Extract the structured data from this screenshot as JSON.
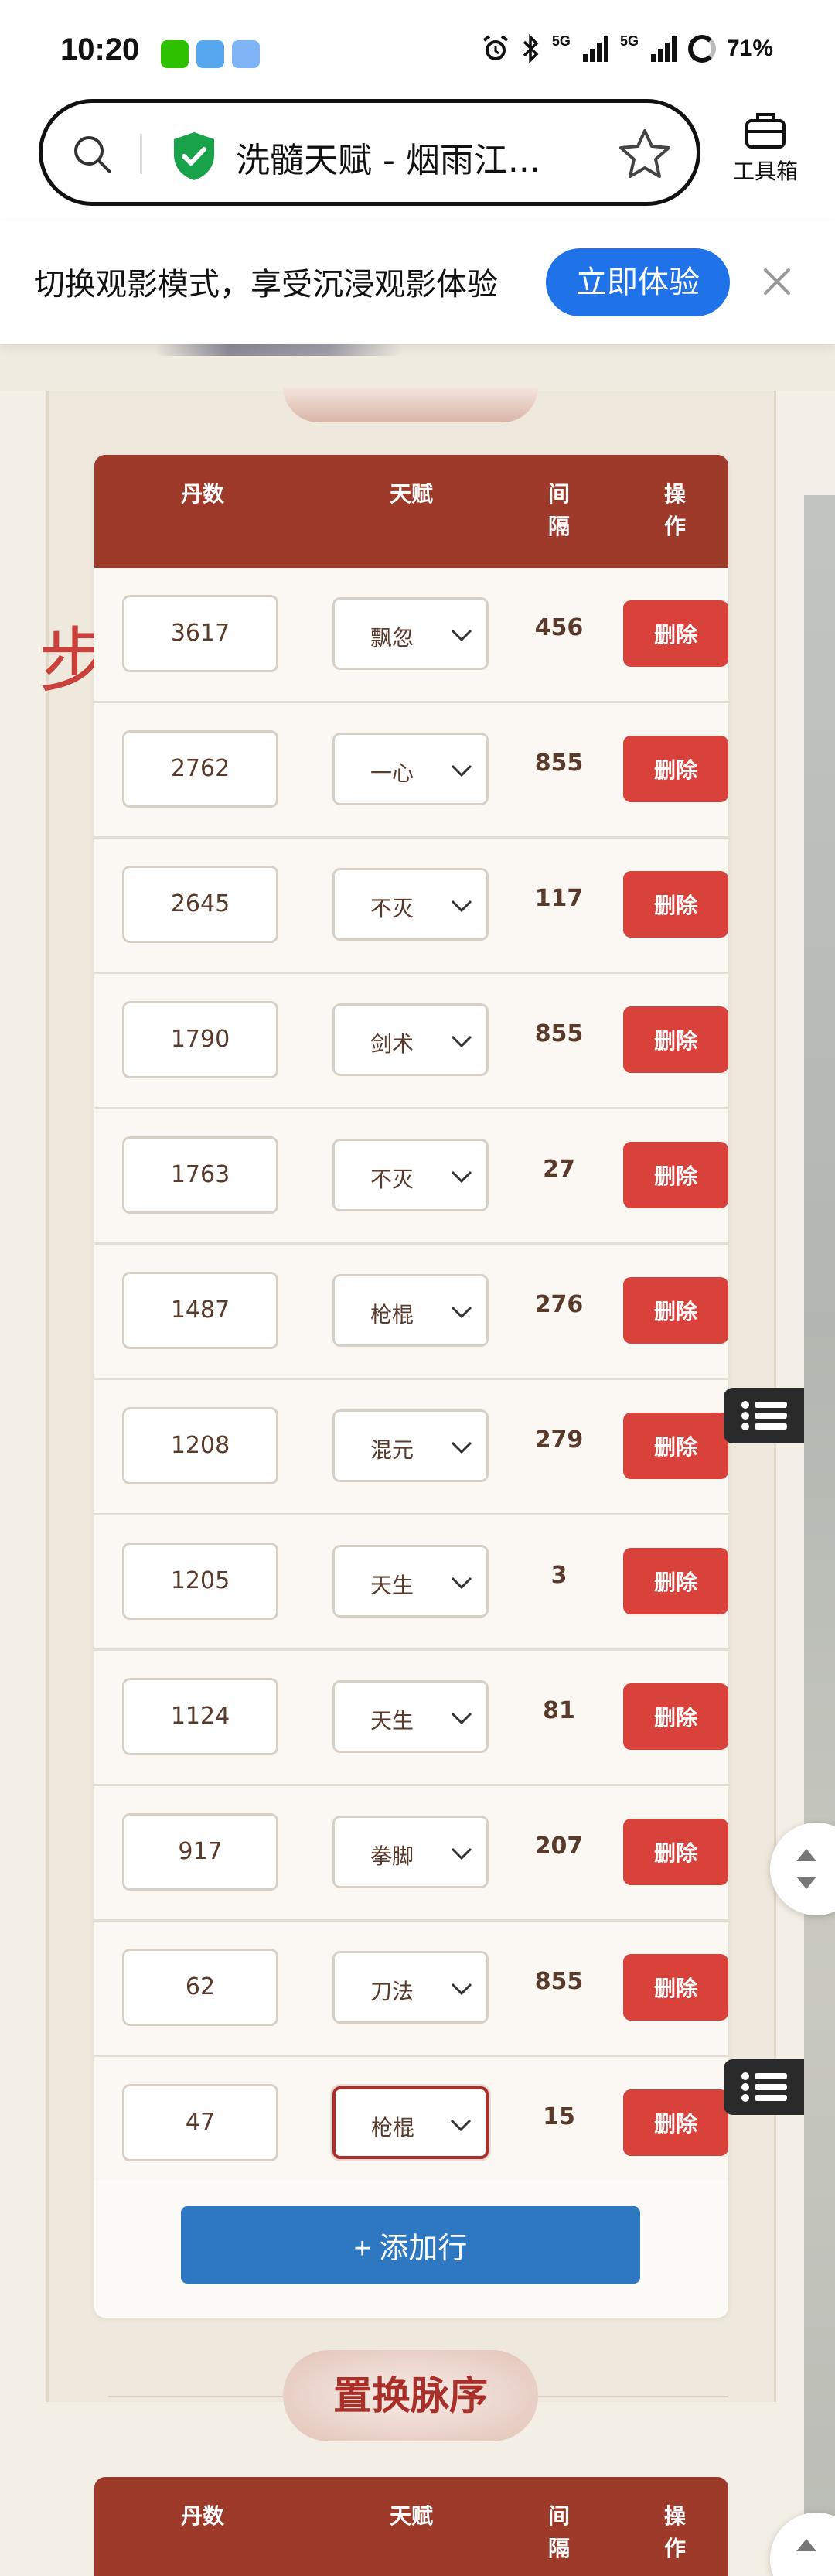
{
  "status_bar": {
    "time": "10:20",
    "network": "5G",
    "battery": "71%"
  },
  "browser": {
    "address_title": "洗髓天赋 - 烟雨江...",
    "toolbox_label": "工具箱"
  },
  "banner": {
    "text": "切换观影模式，享受沉浸观影体验",
    "cta_label": "立即体验"
  },
  "page": {
    "side_char": "步"
  },
  "table": {
    "headers": {
      "dan": "丹数",
      "talent": "天赋",
      "interval_1": "间",
      "interval_2": "隔",
      "action_1": "操",
      "action_2": "作"
    },
    "rows": [
      {
        "dan": "3617",
        "talent": "飘忽",
        "interval": "456",
        "delete": "删除"
      },
      {
        "dan": "2762",
        "talent": "一心",
        "interval": "855",
        "delete": "删除"
      },
      {
        "dan": "2645",
        "talent": "不灭",
        "interval": "117",
        "delete": "删除"
      },
      {
        "dan": "1790",
        "talent": "剑术",
        "interval": "855",
        "delete": "删除"
      },
      {
        "dan": "1763",
        "talent": "不灭",
        "interval": "27",
        "delete": "删除"
      },
      {
        "dan": "1487",
        "talent": "枪棍",
        "interval": "276",
        "delete": "删除"
      },
      {
        "dan": "1208",
        "talent": "混元",
        "interval": "279",
        "delete": "删除"
      },
      {
        "dan": "1205",
        "talent": "天生",
        "interval": "3",
        "delete": "删除"
      },
      {
        "dan": "1124",
        "talent": "天生",
        "interval": "81",
        "delete": "删除"
      },
      {
        "dan": "917",
        "talent": "拳脚",
        "interval": "207",
        "delete": "删除"
      },
      {
        "dan": "62",
        "talent": "刀法",
        "interval": "855",
        "delete": "删除"
      },
      {
        "dan": "47",
        "talent": "枪棍",
        "interval": "15",
        "delete": "删除"
      }
    ],
    "add_row_label": "+ 添加行"
  },
  "section2": {
    "title": "置换脉序",
    "headers": {
      "dan": "丹数",
      "talent": "天赋",
      "interval_1": "间",
      "interval_2": "隔",
      "action_1": "操",
      "action_2": "作"
    }
  },
  "colors": {
    "header_bg": "#9e3a2a",
    "delete_bg": "#d9413b",
    "add_btn_bg": "#2e78c2",
    "banner_btn_bg": "#1f72e8"
  }
}
